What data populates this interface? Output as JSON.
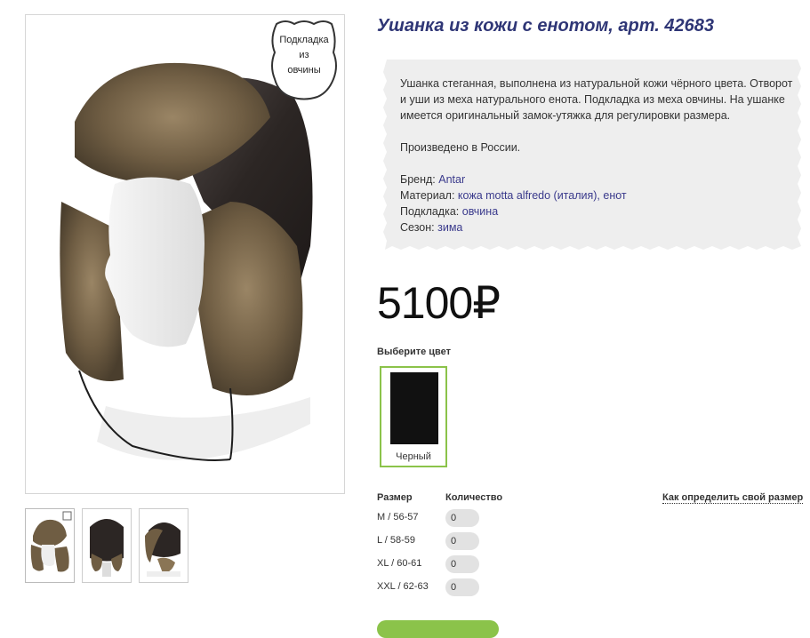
{
  "product": {
    "title": "Ушанка из кожи с енотом, арт. 42683",
    "badge_lines": [
      "Подкладка",
      "из",
      "овчины"
    ],
    "price": "5100₽"
  },
  "description": {
    "text": "Ушанка стеганная, выполнена из натуральной кожи чёрного цвета. Отворот и уши из меха натурального енота. Подкладка из меха овчины. На ушанке имеется оригинальный замок-утяжка для регулировки размера.",
    "origin": "Произведено в России.",
    "specs": [
      {
        "label": "Бренд:",
        "value": "Antar"
      },
      {
        "label": "Материал:",
        "value": "кожа motta alfredo (италия), енот"
      },
      {
        "label": "Подкладка:",
        "value": "овчина"
      },
      {
        "label": "Сезон:",
        "value": "зима"
      }
    ]
  },
  "color": {
    "label": "Выберите цвет",
    "options": [
      {
        "name": "Черный",
        "hex": "#111111"
      }
    ]
  },
  "sizes": {
    "size_header": "Размер",
    "qty_header": "Количество",
    "guide_link": "Как определить свой размер",
    "rows": [
      {
        "name": "M / 56-57",
        "qty": "0"
      },
      {
        "name": "L / 58-59",
        "qty": "0"
      },
      {
        "name": "XL / 60-61",
        "qty": "0"
      },
      {
        "name": "XXL / 62-63",
        "qty": "0"
      }
    ]
  },
  "colors": {
    "title": "#2f3676",
    "accent": "#8bc34a",
    "link": "#3a3a8c"
  }
}
